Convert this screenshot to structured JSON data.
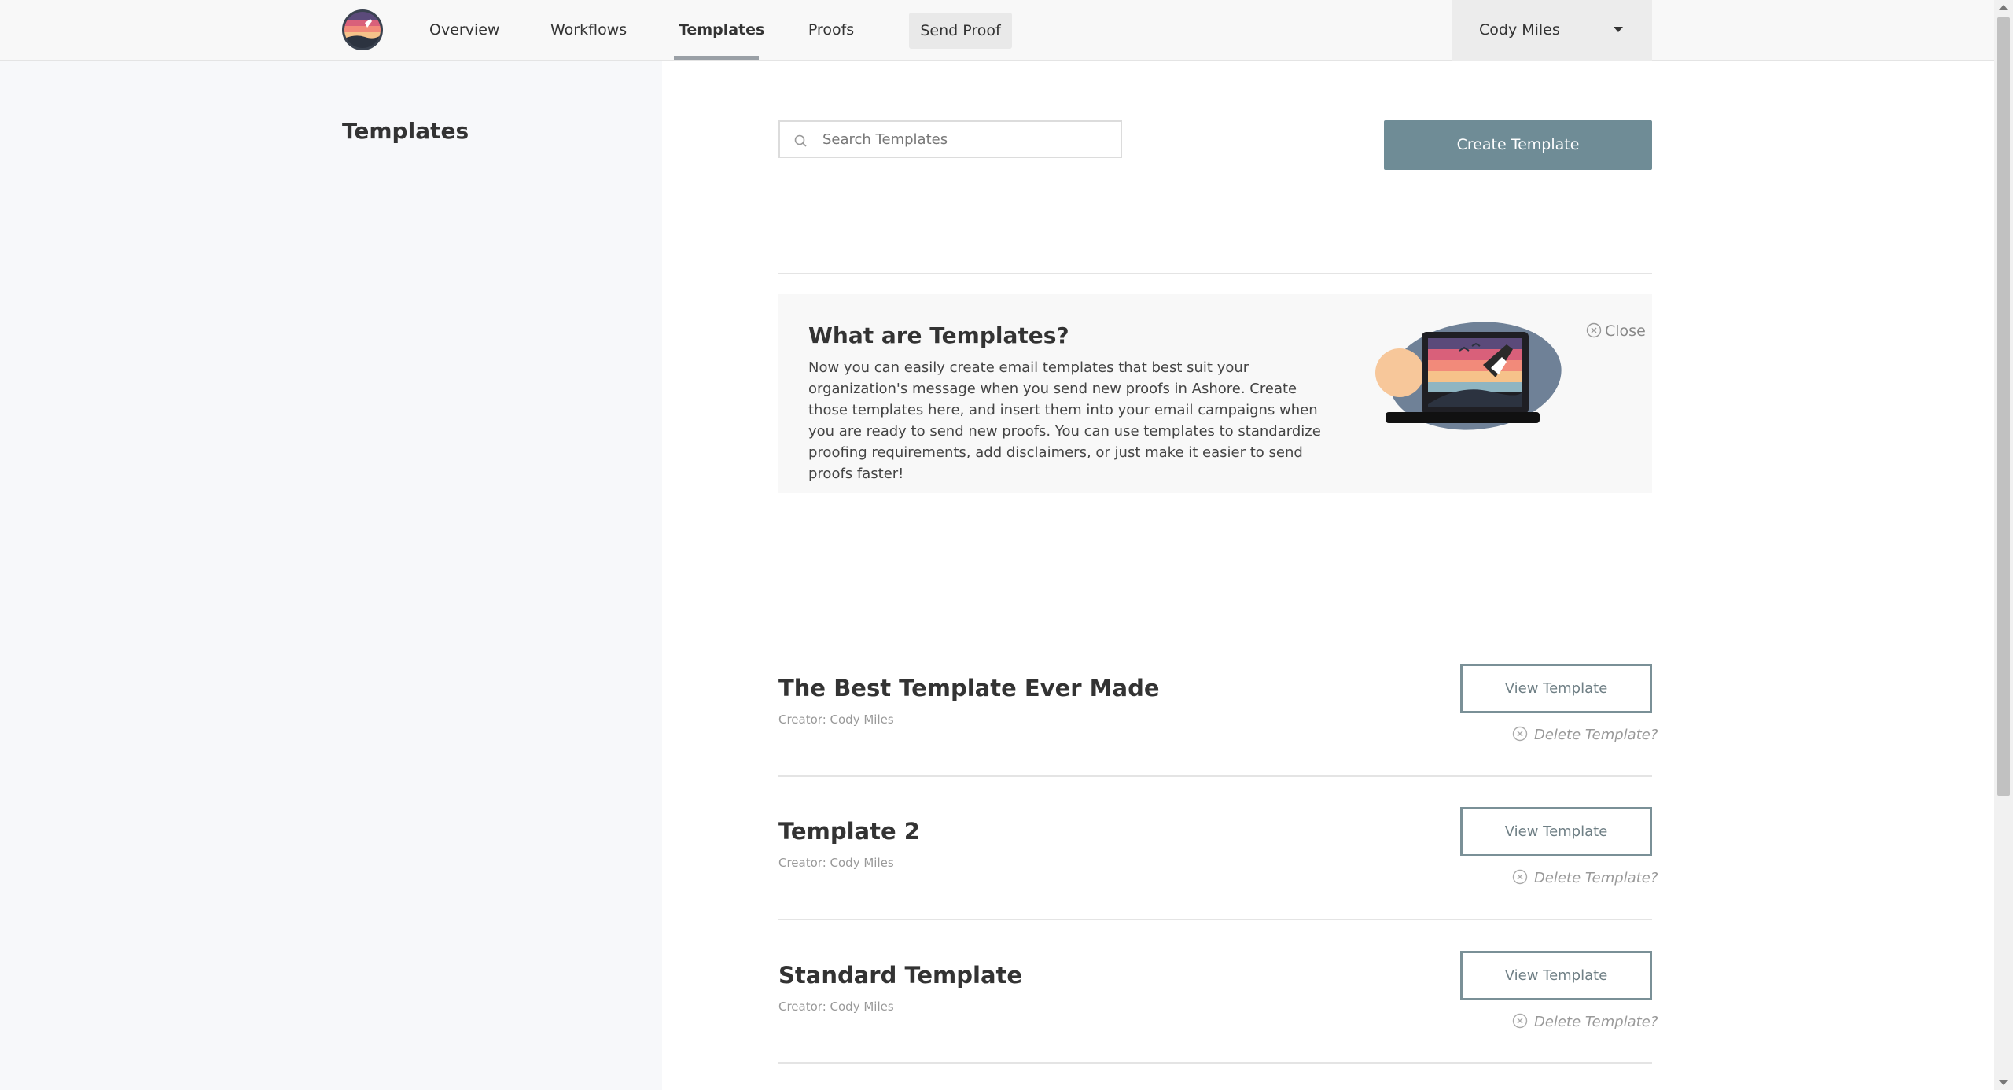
{
  "nav": {
    "logo_icon": "sunset-logo-icon",
    "items": [
      {
        "label": "Overview"
      },
      {
        "label": "Workflows"
      },
      {
        "label": "Templates",
        "active": true
      },
      {
        "label": "Proofs"
      }
    ],
    "send_proof_label": "Send Proof",
    "user": {
      "name": "Cody Miles",
      "caret_icon": "caret-down-icon"
    }
  },
  "sidebar": {
    "title": "Templates"
  },
  "search": {
    "placeholder": "Search Templates",
    "value": "",
    "icon": "search-icon"
  },
  "create_button_label": "Create Template",
  "info": {
    "title": "What are Templates?",
    "body": "Now you can easily create email templates that best suit your organization's message when you send new proofs in Ashore. Create those templates here, and insert them into your email campaigns when you are ready to send new proofs. You can use templates to standardize proofing requirements, add disclaimers, or just make it easier to send proofs faster!",
    "close_label": "Close",
    "illustration": "laptop-message-in-bottle-illustration"
  },
  "templates": [
    {
      "name": "The Best Template Ever Made",
      "creator": "Creator: Cody Miles",
      "view_label": "View Template",
      "delete_label": "Delete Template?"
    },
    {
      "name": "Template 2",
      "creator": "Creator: Cody Miles",
      "view_label": "View Template",
      "delete_label": "Delete Template?"
    },
    {
      "name": "Standard Template",
      "creator": "Creator: Cody Miles",
      "view_label": "View Template",
      "delete_label": "Delete Template?"
    }
  ],
  "colors": {
    "accent_button": "#6f8c96",
    "outline_button": "#7a9097",
    "sidebar_bg": "#f7f8fa",
    "topbar_bg": "#f8f8f8"
  }
}
